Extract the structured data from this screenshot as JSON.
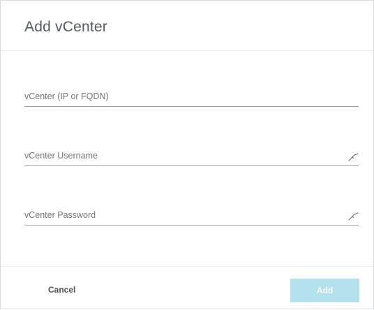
{
  "dialog": {
    "title": "Add vCenter"
  },
  "fields": {
    "host": {
      "placeholder": "vCenter (IP or FQDN)",
      "value": ""
    },
    "username": {
      "placeholder": "vCenter Username",
      "value": "",
      "icon": "key-icon"
    },
    "password": {
      "placeholder": "vCenter Password",
      "value": "",
      "icon": "key-icon"
    }
  },
  "footer": {
    "cancel_label": "Cancel",
    "add_label": "Add",
    "add_enabled": false,
    "add_color": "#b3e2ec"
  }
}
